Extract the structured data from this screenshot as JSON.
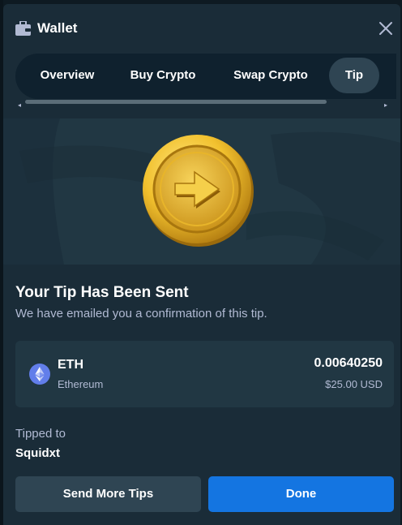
{
  "window": {
    "title": "Wallet",
    "icons": {
      "wallet": "wallet-icon",
      "close": "close-icon"
    }
  },
  "tabs": [
    {
      "label": "Overview",
      "active": false
    },
    {
      "label": "Buy Crypto",
      "active": false
    },
    {
      "label": "Swap Crypto",
      "active": false
    },
    {
      "label": "Tip",
      "active": true
    }
  ],
  "confirmation": {
    "title": "Your Tip Has Been Sent",
    "subtitle": "We have emailed you a confirmation of this tip."
  },
  "transaction": {
    "symbol": "ETH",
    "name": "Ethereum",
    "amount": "0.00640250",
    "usd_value": "$25.00 USD",
    "icon": "ethereum-icon"
  },
  "recipient": {
    "label": "Tipped to",
    "username": "Squidxt"
  },
  "actions": {
    "secondary": "Send More Tips",
    "primary": "Done"
  },
  "colors": {
    "background": "#1a2c38",
    "tab_bar": "#0f212e",
    "card": "#213743",
    "active_tab": "#2f4553",
    "primary_button": "#1475e1",
    "muted_text": "#b1bad3",
    "ethereum": "#627eea",
    "coin_gold": "#f2c12e"
  }
}
